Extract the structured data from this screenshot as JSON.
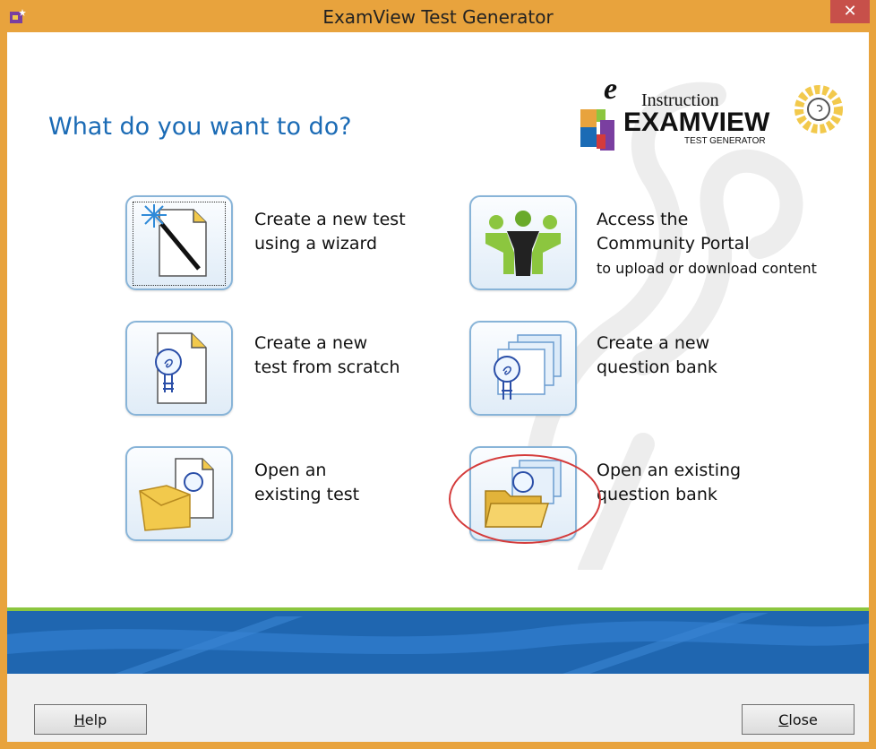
{
  "window": {
    "title": "ExamView Test Generator",
    "close_glyph": "✕"
  },
  "heading": "What do you want to do?",
  "logo": {
    "line1": "Instruction",
    "brand": "EXAMVIEW",
    "sub": "TEST GENERATOR"
  },
  "options": [
    {
      "line1": "Create a new test",
      "line2": "using a wizard",
      "icon": "wizard-wand-icon"
    },
    {
      "line1": "Access the",
      "line2": "Community Portal",
      "line3": "to upload or download content",
      "icon": "community-people-icon"
    },
    {
      "line1": "Create a new",
      "line2": "test from scratch",
      "icon": "new-test-page-icon"
    },
    {
      "line1": "Create a new",
      "line2": "question bank",
      "icon": "new-question-bank-icon"
    },
    {
      "line1": "Open an",
      "line2": "existing test",
      "icon": "open-test-folder-icon"
    },
    {
      "line1": "Open an existing",
      "line2": "question bank",
      "icon": "open-question-bank-folder-icon"
    }
  ],
  "buttons": {
    "help_mn": "H",
    "help_rest": "elp",
    "close_mn": "C",
    "close_rest": "lose"
  },
  "colors": {
    "titlebar": "#e8a33d",
    "heading_blue": "#1b6bb5",
    "close_red": "#c7504a",
    "band_blue": "#1f66b0",
    "band_green": "#8cc63f"
  }
}
